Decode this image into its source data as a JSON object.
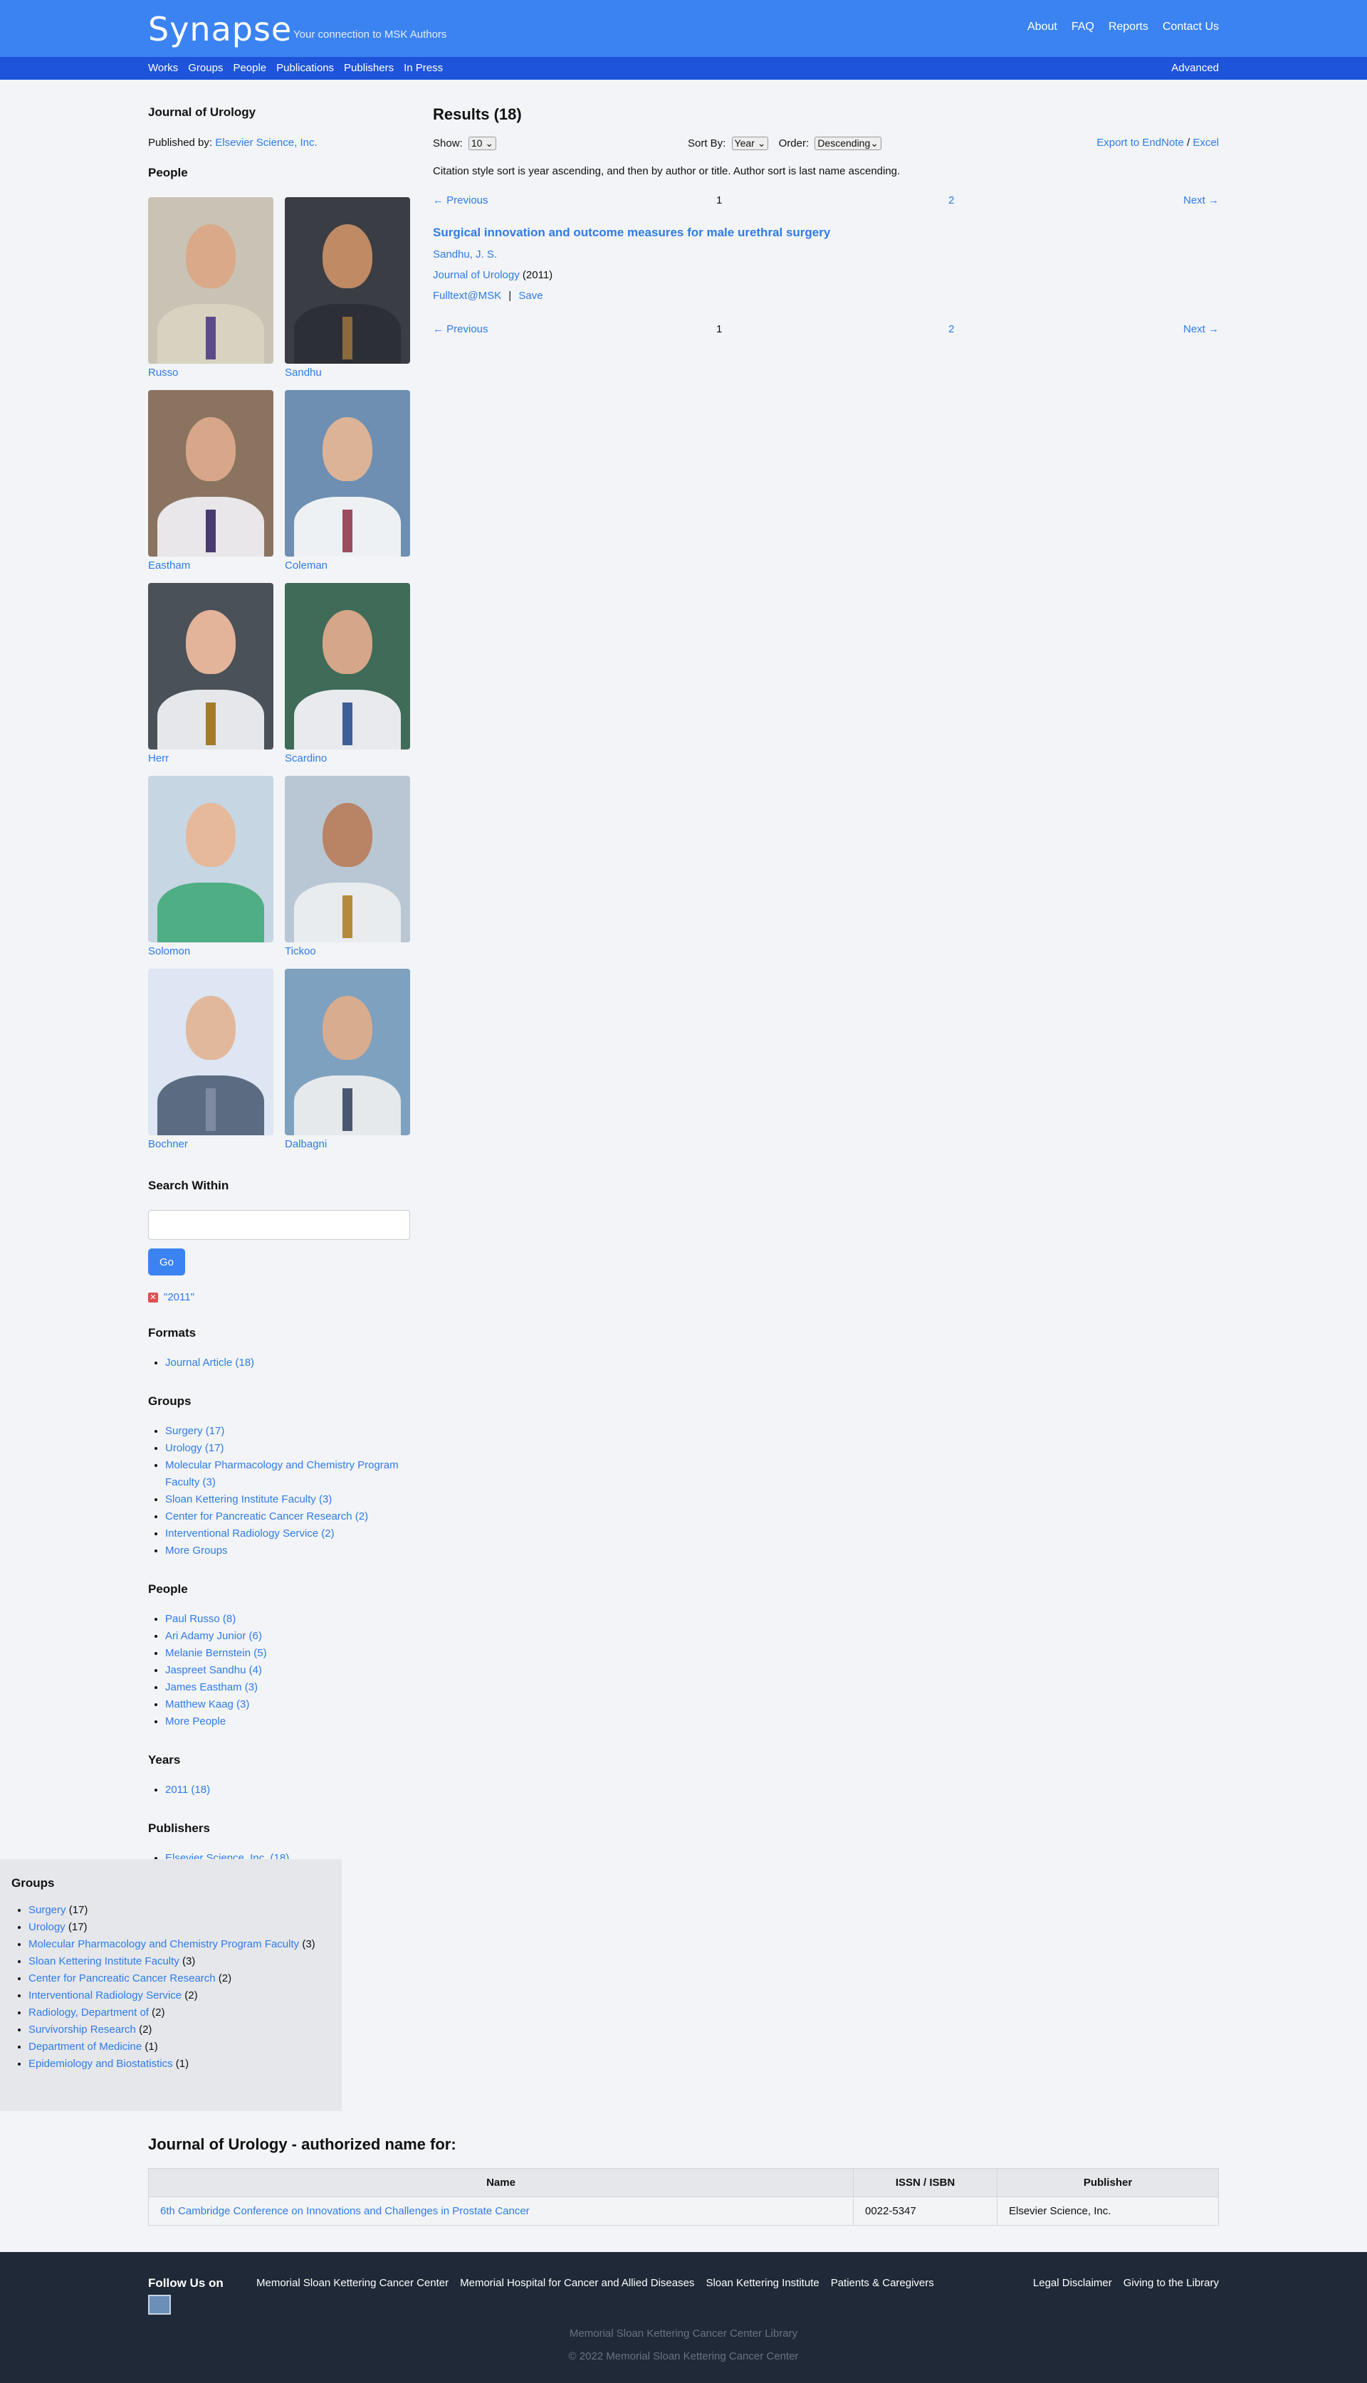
{
  "header": {
    "logo": "Synapse",
    "tagline": "Your connection to MSK Authors",
    "links": [
      "About",
      "FAQ",
      "Reports",
      "Contact Us"
    ]
  },
  "subnav": {
    "items": [
      "Works",
      "Groups",
      "People",
      "Publications",
      "Publishers",
      "In Press"
    ],
    "advanced": "Advanced"
  },
  "journal": {
    "title": "Journal of Urology",
    "published_by_label": "Published by:",
    "publisher": "Elsevier Science, Inc."
  },
  "people_section": {
    "title": "People",
    "people": [
      {
        "name": "Russo",
        "bg": "#c9c3b5",
        "skin": "#d9a989",
        "suit": "#d8d2c0",
        "tie": "#5b4a8a"
      },
      {
        "name": "Sandhu",
        "bg": "#3a3d44",
        "skin": "#c08a64",
        "suit": "#2d2f36",
        "tie": "#8c6a3c"
      },
      {
        "name": "Eastham",
        "bg": "#8a7460",
        "skin": "#d8a688",
        "suit": "#e9e7ea",
        "tie": "#4a3a72"
      },
      {
        "name": "Coleman",
        "bg": "#6e8fb2",
        "skin": "#dcb396",
        "suit": "#eef1f4",
        "tie": "#9b4d5e"
      },
      {
        "name": "Herr",
        "bg": "#4a5158",
        "skin": "#e3b49a",
        "suit": "#e5e7ea",
        "tie": "#a57a2a"
      },
      {
        "name": "Scardino",
        "bg": "#3f6b58",
        "skin": "#d6a688",
        "suit": "#e8eaee",
        "tie": "#3e5f94"
      },
      {
        "name": "Solomon",
        "bg": "#c7d6e3",
        "skin": "#e6b99b",
        "suit": "#4fae84",
        "tie": "#4fae84"
      },
      {
        "name": "Tickoo",
        "bg": "#b9c7d4",
        "skin": "#b98466",
        "suit": "#e9ecef",
        "tie": "#b58b3a"
      },
      {
        "name": "Bochner",
        "bg": "#dde6f2",
        "skin": "#e2b89c",
        "suit": "#5a6b82",
        "tie": "#7d8aa0"
      },
      {
        "name": "Dalbagni",
        "bg": "#7ea1bf",
        "skin": "#d7ac8f",
        "suit": "#e6e9ec",
        "tie": "#49586f"
      }
    ]
  },
  "search_within": {
    "title": "Search Within",
    "value": "",
    "button": "Go",
    "active_filter": "\"2011\""
  },
  "facets": {
    "formats": {
      "title": "Formats",
      "items": [
        "Journal Article (18)"
      ]
    },
    "groups": {
      "title": "Groups",
      "items": [
        "Surgery (17)",
        "Urology (17)",
        "Molecular Pharmacology and Chemistry Program Faculty (3)",
        "Sloan Kettering Institute Faculty (3)",
        "Center for Pancreatic Cancer Research (2)",
        "Interventional Radiology Service (2)",
        "More Groups"
      ]
    },
    "people": {
      "title": "People",
      "items": [
        "Paul Russo (8)",
        "Ari Adamy Junior (6)",
        "Melanie Bernstein (5)",
        "Jaspreet Sandhu (4)",
        "James Eastham (3)",
        "Matthew Kaag (3)",
        "More People"
      ]
    },
    "years": {
      "title": "Years",
      "items": [
        "2011 (18)"
      ]
    },
    "publishers": {
      "title": "Publishers",
      "items": [
        "Elsevier Science, Inc. (18)"
      ]
    }
  },
  "results": {
    "title": "Results (18)",
    "show_label": "Show:",
    "show_value": "10",
    "sort_label": "Sort By:",
    "sort_value": "Year",
    "order_label": "Order:",
    "order_value": "Descending",
    "export_label": "Export to EndNote",
    "export_sep": "/",
    "excel_label": "Excel",
    "note": "Citation style sort is year ascending, and then by author or title. Author sort is last name ascending.",
    "pager": {
      "prev": "← Previous",
      "current": "1",
      "page2": "2",
      "next": "Next →"
    },
    "items": [
      {
        "title": "Surgical innovation and outcome measures for male urethral surgery",
        "author": "Sandhu, J. S.",
        "journal": "Journal of Urology",
        "year": "(2011)",
        "fulltext": "Fulltext@MSK",
        "sep": "|",
        "save": "Save"
      }
    ]
  },
  "groups_box": {
    "title": "Groups",
    "items": [
      {
        "label": "Surgery",
        "count": "(17)"
      },
      {
        "label": "Urology",
        "count": "(17)"
      },
      {
        "label": "Molecular Pharmacology and Chemistry Program Faculty",
        "count": "(3)"
      },
      {
        "label": "Sloan Kettering Institute Faculty",
        "count": "(3)"
      },
      {
        "label": "Center for Pancreatic Cancer Research",
        "count": "(2)"
      },
      {
        "label": "Interventional Radiology Service",
        "count": "(2)"
      },
      {
        "label": "Radiology, Department of",
        "count": "(2)"
      },
      {
        "label": "Survivorship Research",
        "count": "(2)"
      },
      {
        "label": "Department of Medicine",
        "count": "(1)"
      },
      {
        "label": "Epidemiology and Biostatistics",
        "count": "(1)"
      }
    ]
  },
  "authorized": {
    "title": "Journal of Urology - authorized name for:",
    "headers": [
      "Name",
      "ISSN / ISBN",
      "Publisher"
    ],
    "rows": [
      {
        "name": "6th Cambridge Conference on Innovations and Challenges in Prostate Cancer",
        "issn": "0022-5347",
        "publisher": "Elsevier Science, Inc."
      }
    ]
  },
  "footer": {
    "follow": "Follow Us on",
    "links_left": [
      "Memorial Sloan Kettering Cancer Center",
      "Memorial Hospital for Cancer and Allied Diseases",
      "Sloan Kettering Institute",
      "Patients & Caregivers"
    ],
    "links_right": [
      "Legal Disclaimer",
      "Giving to the Library"
    ],
    "library": "Memorial Sloan Kettering Cancer Center Library",
    "copyright": "© 2022 Memorial Sloan Kettering Cancer Center"
  },
  "colors": {
    "accent": "#3b83f1",
    "subnav": "#1e54da",
    "link": "#2f7be8",
    "footer": "#1f2937"
  }
}
